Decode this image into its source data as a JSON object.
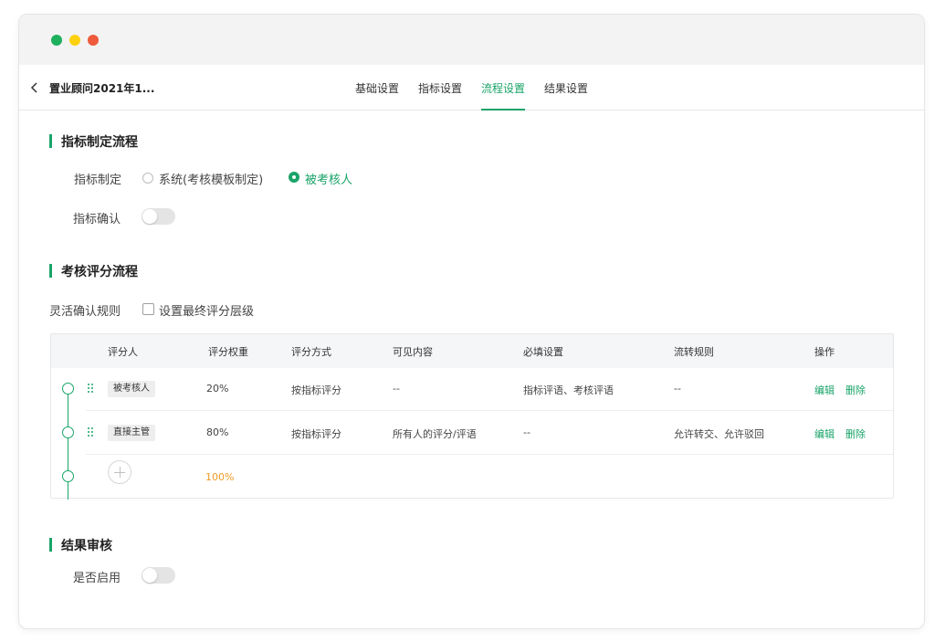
{
  "window": {
    "controls": [
      "close-green",
      "minimize-yellow",
      "maximize-red"
    ]
  },
  "navbar": {
    "title": "置业顾问2021年1...",
    "tabs": [
      {
        "label": "基础设置",
        "active": false
      },
      {
        "label": "指标设置",
        "active": false
      },
      {
        "label": "流程设置",
        "active": true
      },
      {
        "label": "结果设置",
        "active": false
      }
    ]
  },
  "section1": {
    "title": "指标制定流程",
    "formulation": {
      "label": "指标制定",
      "options": [
        {
          "label": "系统(考核模板制定)",
          "checked": false
        },
        {
          "label": "被考核人",
          "checked": true
        }
      ]
    },
    "confirm": {
      "label": "指标确认",
      "enabled": false
    }
  },
  "section2": {
    "title": "考核评分流程",
    "flex_rule_label": "灵活确认规则",
    "final_level_checkbox": {
      "label": "设置最终评分层级",
      "checked": false
    },
    "table": {
      "headers": [
        "评分人",
        "评分权重",
        "评分方式",
        "可见内容",
        "必填设置",
        "流转规则",
        "操作"
      ],
      "rows": [
        {
          "rater": "被考核人",
          "weight": "20%",
          "method": "按指标评分",
          "visible": "--",
          "required": "指标评语、考核评语",
          "flow": "--",
          "edit": "编辑",
          "delete": "删除"
        },
        {
          "rater": "直接主管",
          "weight": "80%",
          "method": "按指标评分",
          "visible": "所有人的评分/评语",
          "required": "--",
          "flow": "允许转交、允许驳回",
          "edit": "编辑",
          "delete": "删除"
        }
      ],
      "total": "100%"
    }
  },
  "section3": {
    "title": "结果审核",
    "enable": {
      "label": "是否启用",
      "enabled": false
    }
  },
  "colors": {
    "accent": "#1aa469",
    "total": "#f19b26"
  }
}
